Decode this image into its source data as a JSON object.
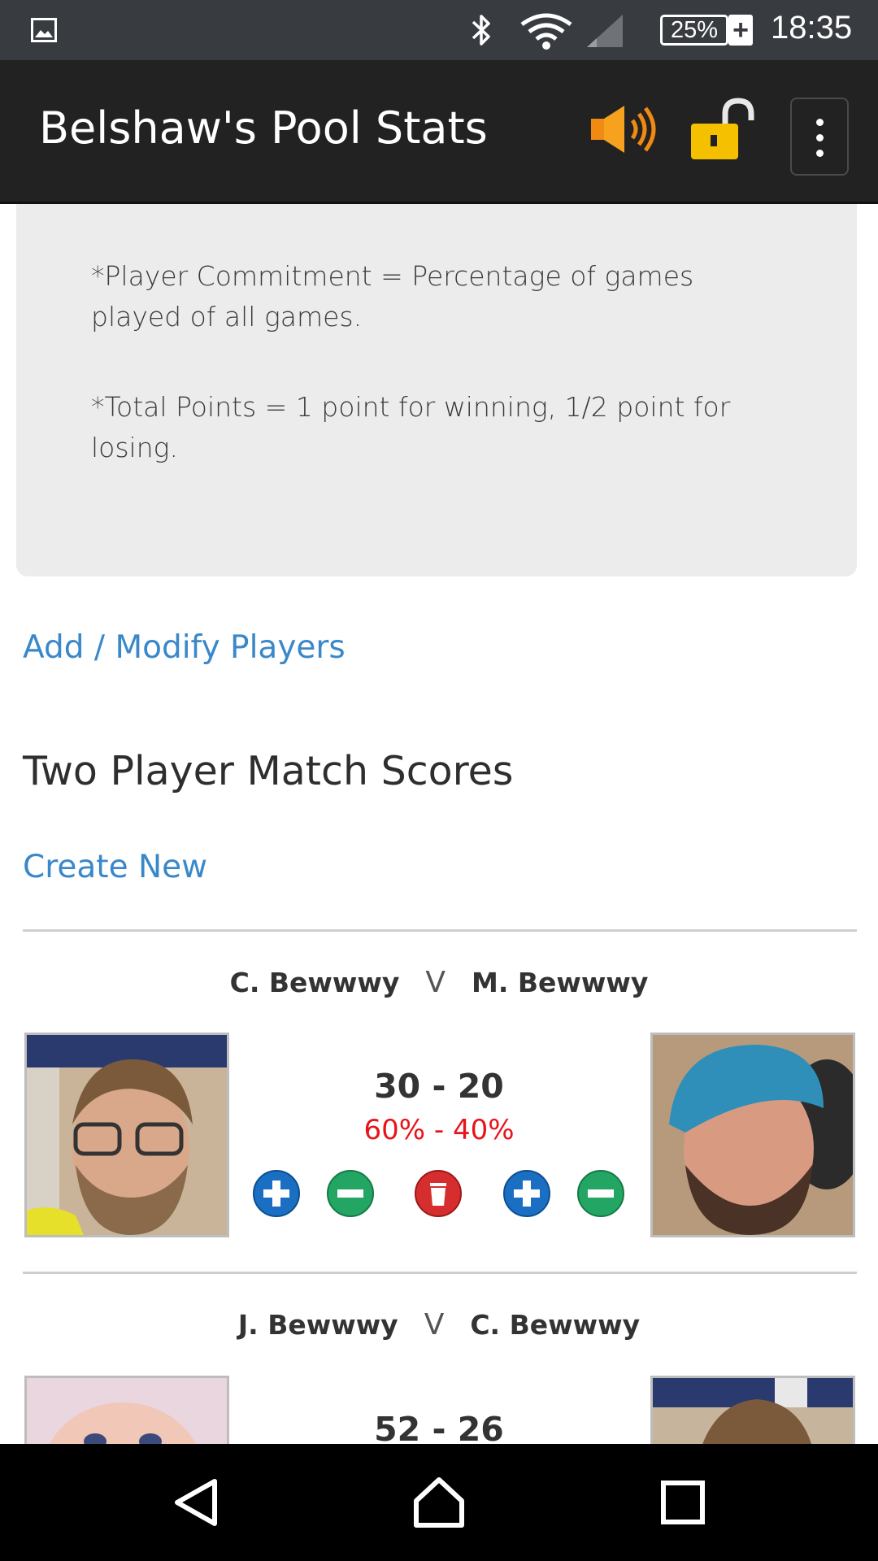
{
  "status_bar": {
    "icons": [
      "gallery-icon",
      "bluetooth-icon",
      "wifi-icon",
      "signal-icon"
    ],
    "battery": "25%",
    "battery_charging": "+",
    "time": "18:35"
  },
  "app_bar": {
    "title": "Belshaw's Pool Stats",
    "icons": [
      "speaker-icon",
      "unlock-icon",
      "overflow-menu-icon"
    ]
  },
  "notes": [
    "*Player Commitment = Percentage of games played of all games.",
    "*Total Points = 1 point for winning, 1/2 point for losing."
  ],
  "links": {
    "modify_players": "Add / Modify Players",
    "create_new": "Create New"
  },
  "section": {
    "heading": "Two Player Match Scores"
  },
  "matches": [
    {
      "player1": "C. Bewwwy",
      "vs": "V",
      "player2": "M. Bewwwy",
      "score": "30 - 20",
      "percent": "60% - 40%"
    },
    {
      "player1": "J. Bewwwy",
      "vs": "V",
      "player2": "C. Bewwwy",
      "score": "52 - 26"
    }
  ],
  "colors": {
    "link": "#3a88c9",
    "percent": "#e8141b",
    "app_bar": "#222222",
    "status_bar": "#383c40"
  },
  "nav_bar": {
    "icons": [
      "back-icon",
      "home-icon",
      "recents-icon"
    ]
  }
}
